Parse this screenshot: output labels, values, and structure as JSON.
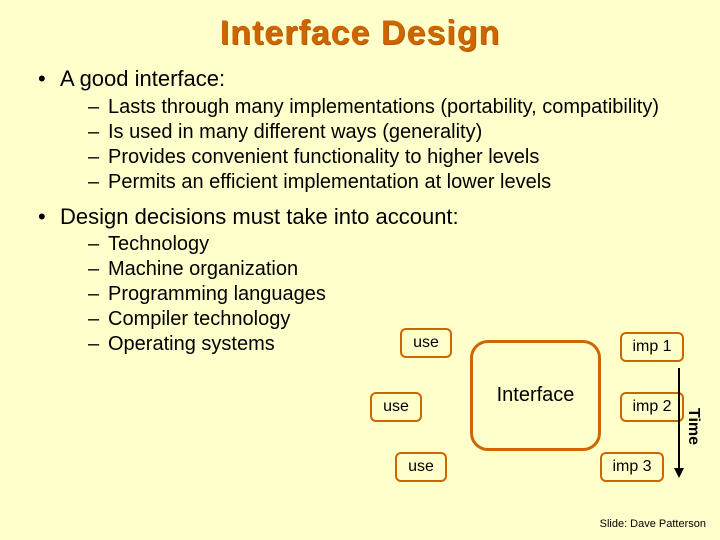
{
  "title": "Interface Design",
  "bullets": {
    "b1": "A good interface:",
    "b1subs": [
      "Lasts through many implementations (portability, compatibility)",
      "Is used in many different ways (generality)",
      "Provides convenient  functionality to higher levels",
      "Permits an efficient implementation at lower levels"
    ],
    "b2": "Design decisions must take into account:",
    "b2subs": [
      "Technology",
      "Machine organization",
      "Programming languages",
      "Compiler technology",
      "Operating systems"
    ]
  },
  "diagram": {
    "interface": "Interface",
    "use1": "use",
    "use2": "use",
    "use3": "use",
    "imp1": "imp 1",
    "imp2": "imp 2",
    "imp3": "imp 3",
    "time": "Time"
  },
  "credit": "Slide: Dave Patterson"
}
